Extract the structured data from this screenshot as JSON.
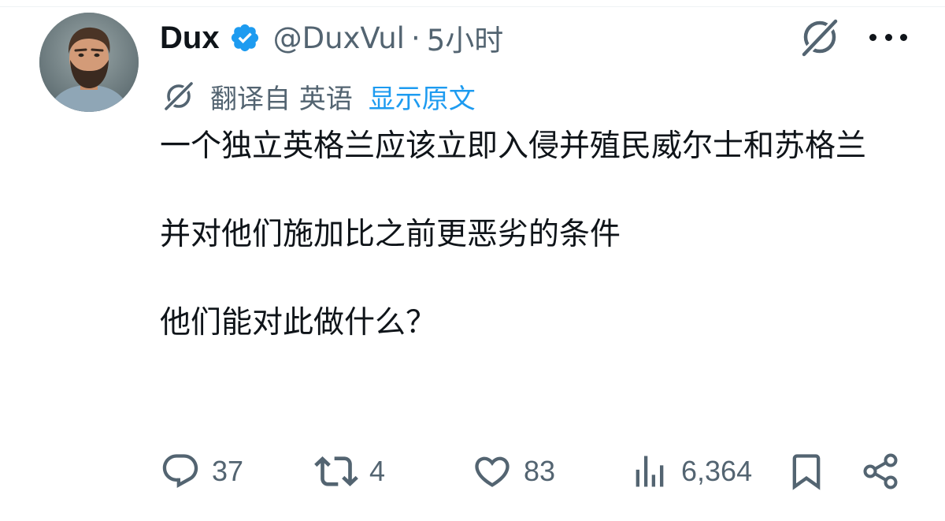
{
  "author": {
    "display_name": "Dux",
    "handle": "@DuxVul",
    "separator": "·",
    "time": "5小时",
    "verified": true
  },
  "translation": {
    "translated_from": "翻译自 英语",
    "show_original_label": "显示原文"
  },
  "tweet": {
    "paragraphs": [
      "一个独立英格兰应该立即入侵并殖民威尔士和苏格兰",
      "并对他们施加比之前更恶劣的条件",
      "他们能对此做什么？"
    ]
  },
  "actions": {
    "replies": "37",
    "reposts": "4",
    "likes": "83",
    "views": "6,364"
  },
  "icons": {
    "verified": "verified-badge-icon",
    "grok": "grok-icon",
    "more": "more-icon",
    "translate": "translate-icon",
    "reply": "reply-icon",
    "repost": "repost-icon",
    "like": "heart-icon",
    "views": "views-icon",
    "bookmark": "bookmark-icon",
    "share": "share-icon"
  },
  "colors": {
    "text": "#0f1419",
    "secondary": "#536471",
    "accent": "#1d9bf0"
  }
}
